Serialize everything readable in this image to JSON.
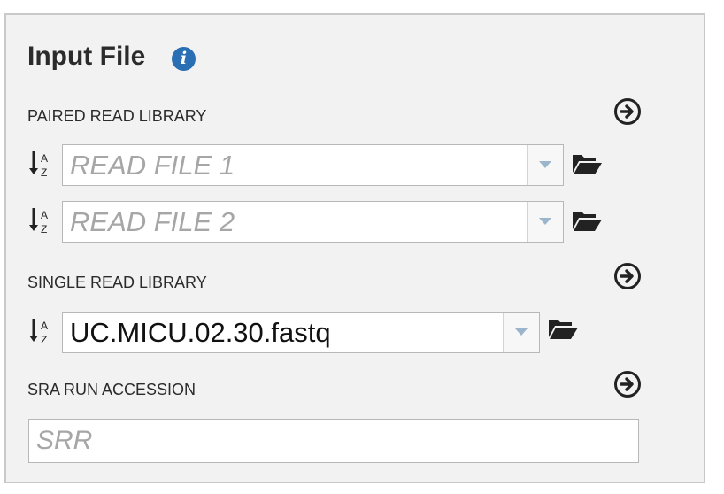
{
  "panel": {
    "title": "Input File",
    "info_icon": "info-icon"
  },
  "paired": {
    "label": "PAIRED READ LIBRARY",
    "read1_placeholder": "READ FILE 1",
    "read2_placeholder": "READ FILE 2"
  },
  "single": {
    "label": "SINGLE READ LIBRARY",
    "value": "UC.MICU.02.30.fastq"
  },
  "sra": {
    "label": "SRA RUN ACCESSION",
    "placeholder": "SRR"
  },
  "icons": {
    "add": "arrow-circle-right-icon",
    "sort": "sort-alpha-icon",
    "folder": "folder-open-icon",
    "caret": "chevron-down-icon"
  },
  "colors": {
    "info_blue": "#2a6eb4",
    "panel_bg": "#f2f2f2",
    "placeholder_gray": "#a6a6a6"
  }
}
